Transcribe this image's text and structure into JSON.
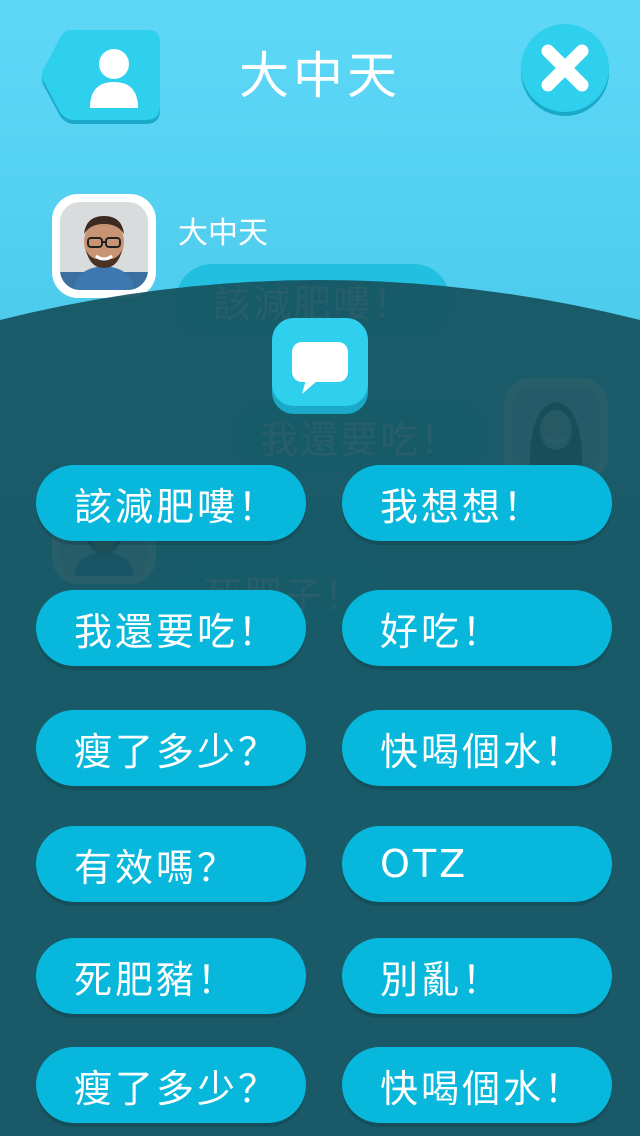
{
  "header": {
    "title": "大中天",
    "back_icon": "user-icon",
    "close_icon": "close-icon"
  },
  "chat": {
    "sender_name": "大中天",
    "messages": [
      {
        "text": "該減肥嘍！"
      },
      {
        "text": "我還要吃！"
      },
      {
        "text": "死肥子！"
      }
    ]
  },
  "phrases": [
    {
      "label": "該減肥嘍！"
    },
    {
      "label": "我想想！"
    },
    {
      "label": "我還要吃！"
    },
    {
      "label": "好吃！"
    },
    {
      "label": "瘦了多少？"
    },
    {
      "label": "快喝個水！"
    },
    {
      "label": "有效嗎？"
    },
    {
      "label": "OTZ"
    },
    {
      "label": "死肥豬！"
    },
    {
      "label": "別亂！"
    },
    {
      "label": "瘦了多少？"
    },
    {
      "label": "快喝個水！"
    }
  ],
  "colors": {
    "sky": "#5fd8f7",
    "panel": "#1f5a69",
    "button": "#07b8dc",
    "text": "#ffffff"
  }
}
